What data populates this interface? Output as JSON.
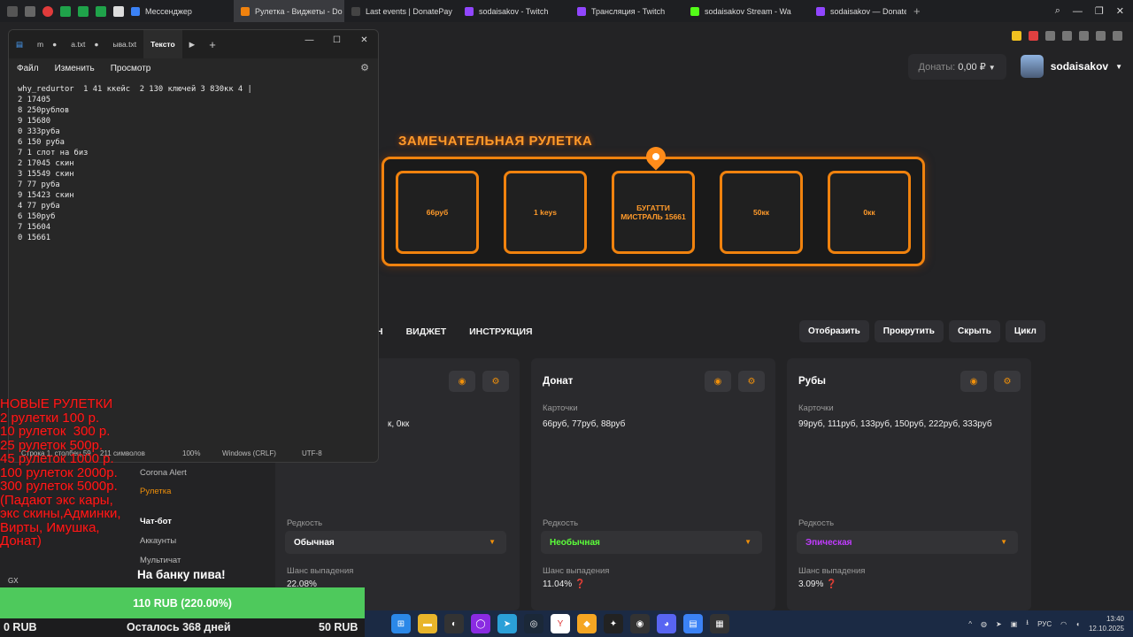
{
  "browser": {
    "tabs": [
      {
        "label": "Мессенджер",
        "color": "#3b82f6",
        "active": false
      },
      {
        "label": "Рулетка - Виджеты - Do",
        "color": "#f0820e",
        "active": true
      },
      {
        "label": "Last events | DonatePay",
        "color": "#444444",
        "active": false
      },
      {
        "label": "sodaisakov - Twitch",
        "color": "#9146ff",
        "active": false
      },
      {
        "label": "Трансляция - Twitch",
        "color": "#9146ff",
        "active": false
      },
      {
        "label": "sodaisakov Stream - Wa",
        "color": "#53fc18",
        "active": false
      },
      {
        "label": "sodaisakov — DonatePay",
        "color": "#9146ff",
        "active": false
      }
    ]
  },
  "header": {
    "donat_label": "Донаты:",
    "donat_value": "0,00 ₽",
    "username": "sodaisakov"
  },
  "roulette": {
    "title": "ЗАМЕЧАТЕЛЬНАЯ РУЛЕТКА",
    "cells": [
      "66руб",
      "1 keys",
      "БУГАТТИ МИСТРАЛЬ 15661",
      "50кк",
      "0кк"
    ]
  },
  "nav_tabs": [
    "Н",
    "ВИДЖЕТ",
    "ИНСТРУКЦИЯ"
  ],
  "actions": [
    "Отобразить",
    "Прокрутить",
    "Скрыть",
    "Цикл"
  ],
  "cards": [
    {
      "title": "",
      "cards_label": "",
      "cards_value": "к, 0кк",
      "rarity_label": "Редкость",
      "rarity_value": "Обычная",
      "rarity_color": "#ffffff",
      "chance_label": "Шанс выпадения",
      "chance_value": "22.08%"
    },
    {
      "title": "Донат",
      "cards_label": "Карточки",
      "cards_value": "66руб, 77руб, 88руб",
      "rarity_label": "Редкость",
      "rarity_value": "Необычная",
      "rarity_color": "#5cff3a",
      "chance_label": "Шанс выпадения",
      "chance_value": "11.04%"
    },
    {
      "title": "Рубы",
      "cards_label": "Карточки",
      "cards_value": "99руб, 111руб, 133руб, 150руб, 222руб, 333руб",
      "rarity_label": "Редкость",
      "rarity_value": "Эпическая",
      "rarity_color": "#c13cff",
      "chance_label": "Шанс выпадения",
      "chance_value": "3.09%"
    }
  ],
  "sidebar": {
    "items": [
      "Corona Alert",
      "Рулетка",
      "Чат-бот",
      "Аккаунты",
      "Мультичат"
    ]
  },
  "notepad": {
    "tabs": [
      "m",
      "a.txt",
      "ыва.txt",
      "Тексто"
    ],
    "menu": [
      "Файл",
      "Изменить",
      "Просмотр"
    ],
    "text": "why_redurtor  1 41 ккейс  2 130 ключей 3 830кк 4 |\n2 17405\n8 250рублов\n9 15680\n0 333руба\n6 150 руба\n7 1 слот на биз\n2 17045 скин\n3 15549 скин\n7 77 руба\n9 15423 скин\n4 77 руба\n6 150руб\n7 15604\n0 15661",
    "status_pos": "Строка 1, столбец 59",
    "status_chars": "211 символов",
    "status_zoom": "100%",
    "status_eol": "Windows (CRLF)",
    "status_enc": "UTF-8"
  },
  "overlay": {
    "red_text": "НОВЫЕ РУЛЕТКИ\n2 рулетки 100 р.\n10 рулеток  300 р.\n25 рулеток 500р.\n45 рулеток 1000 р.\n100 рулеток 2000р.\n300 рулеток 5000р.\n(Падают экс кары,\nэкс скины,Админки,\nВирты, Имушка,\nДонат)",
    "goal_title": "На банку пива!",
    "goal_progress": "110 RUB (220.00%)",
    "goal_left": "0 RUB",
    "goal_days": "Осталось 368 дней",
    "goal_target": "50 RUB",
    "gx": "GX"
  },
  "taskbar": {
    "lang": "РУС",
    "time": "13:40",
    "date": "12.10.2025"
  }
}
